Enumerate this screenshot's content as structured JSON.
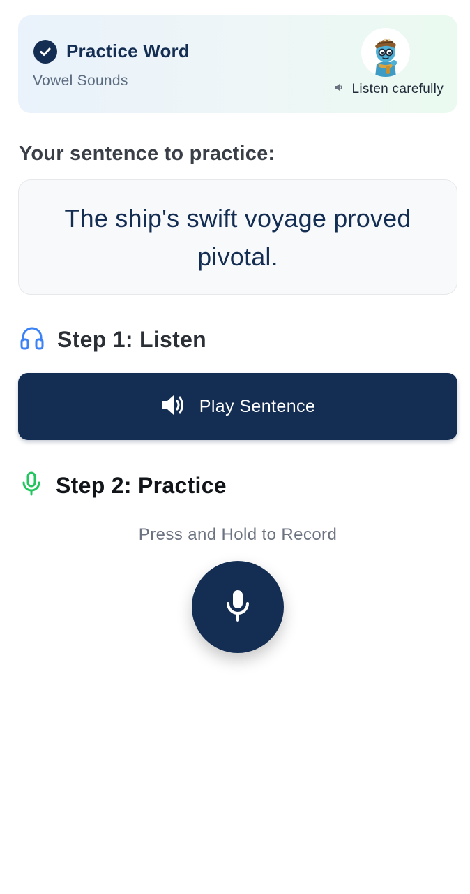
{
  "header": {
    "title": "Practice Word",
    "subtitle": "Vowel Sounds",
    "listen_hint": "Listen carefully"
  },
  "prompt": {
    "label": "Your sentence to practice:",
    "sentence": "The ship's swift voyage proved pivotal."
  },
  "step1": {
    "title": "Step 1: Listen",
    "button_label": "Play Sentence"
  },
  "step2": {
    "title": "Step 2: Practice",
    "record_hint": "Press and Hold to Record"
  },
  "icons": {
    "header": "check-circle-icon",
    "avatar": "tutor-character-avatar",
    "listen_hint": "speaker-icon",
    "step1": "headphones-icon",
    "play": "speaker-volume-icon",
    "step2": "microphone-icon",
    "record": "microphone-icon"
  },
  "colors": {
    "primary": "#142d52",
    "step1_icon": "#3b82f6",
    "step2_icon": "#22c55e",
    "header_gradient_start": "#eaf2fb",
    "header_gradient_end": "#eafaf0"
  }
}
